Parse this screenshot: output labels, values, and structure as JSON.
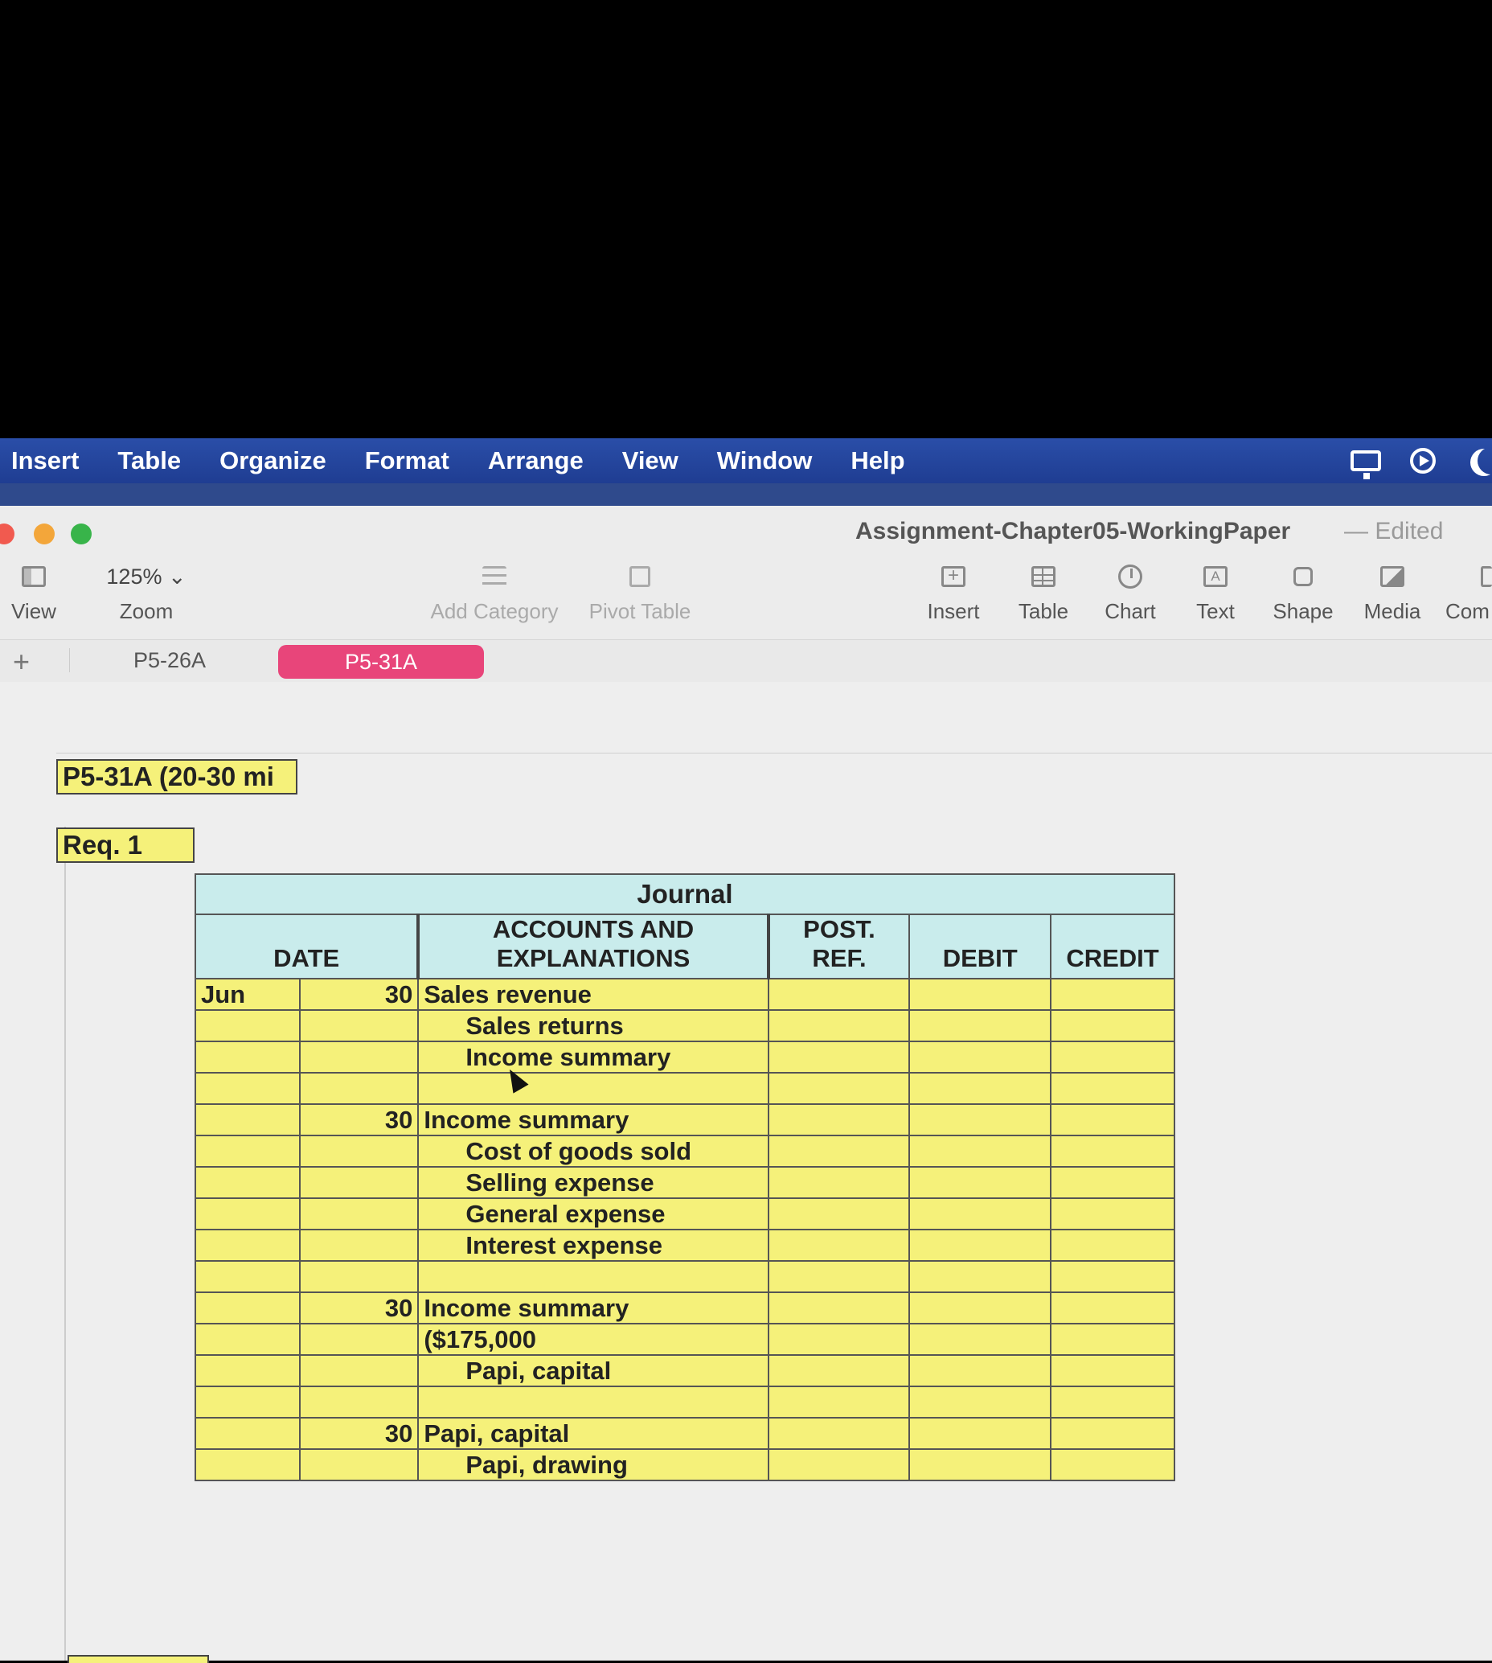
{
  "menubar": {
    "items": [
      "Insert",
      "Table",
      "Organize",
      "Format",
      "Arrange",
      "View",
      "Window",
      "Help"
    ],
    "status_icons": [
      "monitor-icon",
      "play-circle-icon",
      "moon-icon"
    ]
  },
  "window": {
    "title": "Assignment-Chapter05-WorkingPaper",
    "title_suffix": "— Edited"
  },
  "toolbar": {
    "view_label": "View",
    "zoom_value": "125% ⌄",
    "zoom_label": "Zoom",
    "add_category_label": "Add Category",
    "pivot_table_label": "Pivot Table",
    "insert_label": "Insert",
    "table_label": "Table",
    "chart_label": "Chart",
    "text_label": "Text",
    "shape_label": "Shape",
    "media_label": "Media",
    "comment_label": "Com"
  },
  "tabs": {
    "add": "+",
    "items": [
      "P5-26A",
      "P5-31A"
    ],
    "active": "P5-31A"
  },
  "sheet": {
    "problem_label": "P5-31A  (20-30 mi",
    "req_label": "Req. 1"
  },
  "journal": {
    "title": "Journal",
    "headers": {
      "date": "DATE",
      "accounts": "ACCOUNTS AND EXPLANATIONS",
      "post_ref": "POST. REF.",
      "debit": "DEBIT",
      "credit": "CREDIT"
    },
    "rows": [
      {
        "month": "Jun",
        "day": "30",
        "account": "Sales revenue",
        "indent": false
      },
      {
        "month": "",
        "day": "",
        "account": "Sales returns",
        "indent": true
      },
      {
        "month": "",
        "day": "",
        "account": "Income summary",
        "indent": true
      },
      {
        "month": "",
        "day": "",
        "account": "",
        "indent": false
      },
      {
        "month": "",
        "day": "30",
        "account": "Income summary",
        "indent": false
      },
      {
        "month": "",
        "day": "",
        "account": "Cost of goods sold",
        "indent": true
      },
      {
        "month": "",
        "day": "",
        "account": "Selling expense",
        "indent": true
      },
      {
        "month": "",
        "day": "",
        "account": "General expense",
        "indent": true
      },
      {
        "month": "",
        "day": "",
        "account": "Interest expense",
        "indent": true
      },
      {
        "month": "",
        "day": "",
        "account": "",
        "indent": false
      },
      {
        "month": "",
        "day": "30",
        "account": "Income summary",
        "indent": false
      },
      {
        "month": "",
        "day": "",
        "account": "($175,000",
        "indent": false
      },
      {
        "month": "",
        "day": "",
        "account": "Papi, capital",
        "indent": true
      },
      {
        "month": "",
        "day": "",
        "account": "",
        "indent": false
      },
      {
        "month": "",
        "day": "30",
        "account": "Papi, capital",
        "indent": false
      },
      {
        "month": "",
        "day": "",
        "account": "Papi, drawing",
        "indent": true
      }
    ]
  },
  "colors": {
    "menubar": "#1f3d92",
    "active_tab": "#e8457a",
    "cell_fill": "#f5f17a",
    "header_fill": "#c9ecec"
  }
}
